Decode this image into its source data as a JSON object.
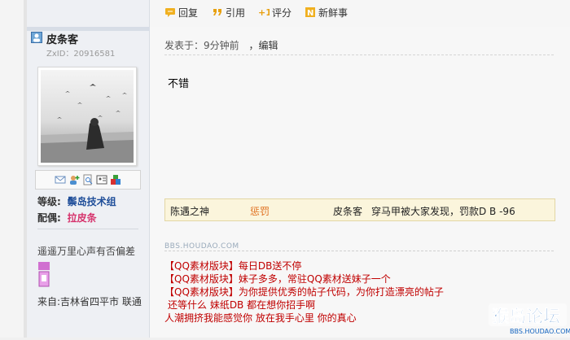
{
  "toolbar": {
    "reply": "回复",
    "quote": "引用",
    "rate": "评分",
    "new": "新鲜事"
  },
  "user": {
    "name": "皮条客",
    "id": "ZxID：20916581",
    "level_label": "等级:",
    "level_value": "鬃岛技术组",
    "spouse_label": "配偶:",
    "spouse_value": "拉皮条",
    "motto": "遥遥万里心声有否偏差",
    "from": "来自:吉林省四平市 联通"
  },
  "post": {
    "meta": "发表于：9分钟前",
    "edit": "，编辑",
    "body": "不错"
  },
  "rating": {
    "rater": "陈遇之神",
    "type": "惩罚",
    "target": "皮条客",
    "reason": "穿马甲被大家发现，罚款D B -96"
  },
  "signature": {
    "banner": "BBS.HOUDAO.COM",
    "lines": [
      "【QQ素材版块】每日DB送不停",
      "【QQ素材版块】妹子多多，常驻QQ素材送妹子一个",
      "【QQ素材版块】为你提供优秀的帖子代码，为你打造漂亮的帖子",
      "还等什么 妹纸DB 都在想你招手啊",
      "人潮拥挤我能感觉你 放在我手心里 你的真心"
    ]
  },
  "watermark": {
    "text": "猴岛论坛",
    "url": "BBS.HOUDAO.COM"
  },
  "colors": {
    "accent_blue": "#1f4e99",
    "accent_pink": "#d6336c",
    "signature_red": "#c00000",
    "penalty_orange": "#e07020"
  }
}
